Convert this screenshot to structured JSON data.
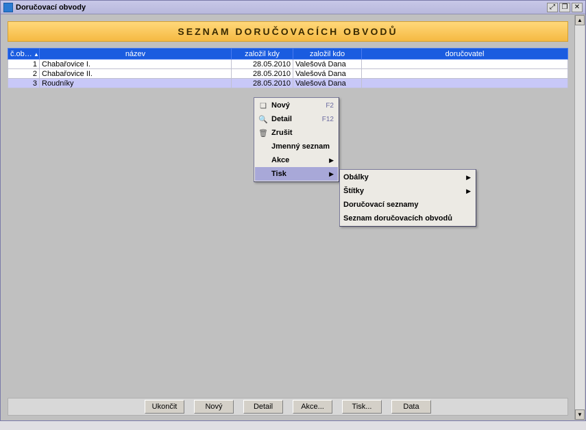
{
  "window": {
    "title": "Doručovací obvody"
  },
  "banner": "SEZNAM DORUČOVACÍCH OBVODŮ",
  "columns": {
    "num": "č.ob…",
    "name": "název",
    "created_when": "založil kdy",
    "created_who": "založil kdo",
    "deliverer": "doručovatel"
  },
  "rows": [
    {
      "num": "1",
      "name": "Chabařovice I.",
      "date": "28.05.2010",
      "who": "Valešová Dana",
      "deliv": ""
    },
    {
      "num": "2",
      "name": "Chabařovice II.",
      "date": "28.05.2010",
      "who": "Valešová Dana",
      "deliv": ""
    },
    {
      "num": "3",
      "name": "Roudníky",
      "date": "28.05.2010",
      "who": "Valešová Dana",
      "deliv": ""
    }
  ],
  "context_menu": {
    "items": [
      {
        "label": "Nový",
        "shortcut": "F2",
        "icon": "new-icon"
      },
      {
        "label": "Detail",
        "shortcut": "F12",
        "icon": "detail-icon"
      },
      {
        "label": "Zrušit",
        "shortcut": "",
        "icon": "delete-icon"
      },
      {
        "label": "Jmenný seznam",
        "shortcut": "",
        "icon": ""
      },
      {
        "label": "Akce",
        "submenu": true
      },
      {
        "label": "Tisk",
        "submenu": true,
        "highlight": true
      }
    ]
  },
  "submenu_tisk": {
    "items": [
      {
        "label": "Obálky",
        "submenu": true
      },
      {
        "label": "Štítky",
        "submenu": true
      },
      {
        "label": "Doručovací seznamy"
      },
      {
        "label": "Seznam doručovacích obvodů"
      }
    ]
  },
  "buttons": {
    "close": "Ukončit",
    "new": "Nový",
    "detail": "Detail",
    "akce": "Akce...",
    "tisk": "Tisk...",
    "data": "Data"
  }
}
